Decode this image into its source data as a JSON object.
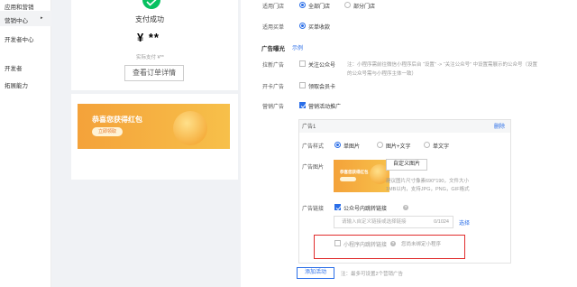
{
  "sidebar": {
    "items": [
      {
        "label": "应用和营销"
      },
      {
        "label": "营销中心"
      },
      {
        "label": "开发者中心"
      },
      {
        "label": "开发者"
      },
      {
        "label": "拓展能力"
      }
    ],
    "arrow": "▸"
  },
  "preview": {
    "status": "支付成功",
    "amount": "¥ **",
    "actual": "实际支付 ¥**",
    "order_button": "查看订单详情",
    "banner_title": "恭喜您获得红包",
    "banner_button": "立即领取"
  },
  "form": {
    "store_label": "适用门店",
    "store_options": [
      "全部门店",
      "部分门店"
    ],
    "store_selected": 0,
    "method_label": "适用买单",
    "method_option": "买单收款",
    "ad_section_title": "广告曝光",
    "ad_section_link": "示例",
    "follow_label": "拉新广告",
    "follow_option": "关注公众号",
    "follow_hint_1": "注：小程序需前往微信小程序后台 “设置” -> “关注公众号” 中设置需展示的公众号（设置",
    "follow_hint_2": "的公众号需与小程序主体一致）",
    "card_label": "开卡广告",
    "card_option": "领取会员卡",
    "marketing_label": "营销广告",
    "marketing_option": "营销活动推广"
  },
  "ad_panel": {
    "title": "广告1",
    "delete": "删除",
    "style_label": "广告样式",
    "style_options": [
      "单图片",
      "图片+文字",
      "单文字"
    ],
    "image_label": "广告图片",
    "custom_image_button": "自定义图片",
    "image_hint_1": "建议图片尺寸像素690*190，文件大小",
    "image_hint_2": "1MB以内，支持JPG，PNG，GIF格式",
    "link_label": "广告链接",
    "link_option": "公众号内跳转链接",
    "link_placeholder": "请输入自定义链接或选择链接",
    "link_counter": "0/1024",
    "select_link": "选择",
    "mini_option": "小程序内跳转链接",
    "mini_hint": "您尚未绑定小程序"
  },
  "footer": {
    "add_button": "添加活动",
    "add_hint": "注：最多可设置2个营销广告"
  },
  "colors": {
    "accent": "#2a6ee8",
    "success": "#07c160",
    "highlight": "#e02c2c"
  }
}
